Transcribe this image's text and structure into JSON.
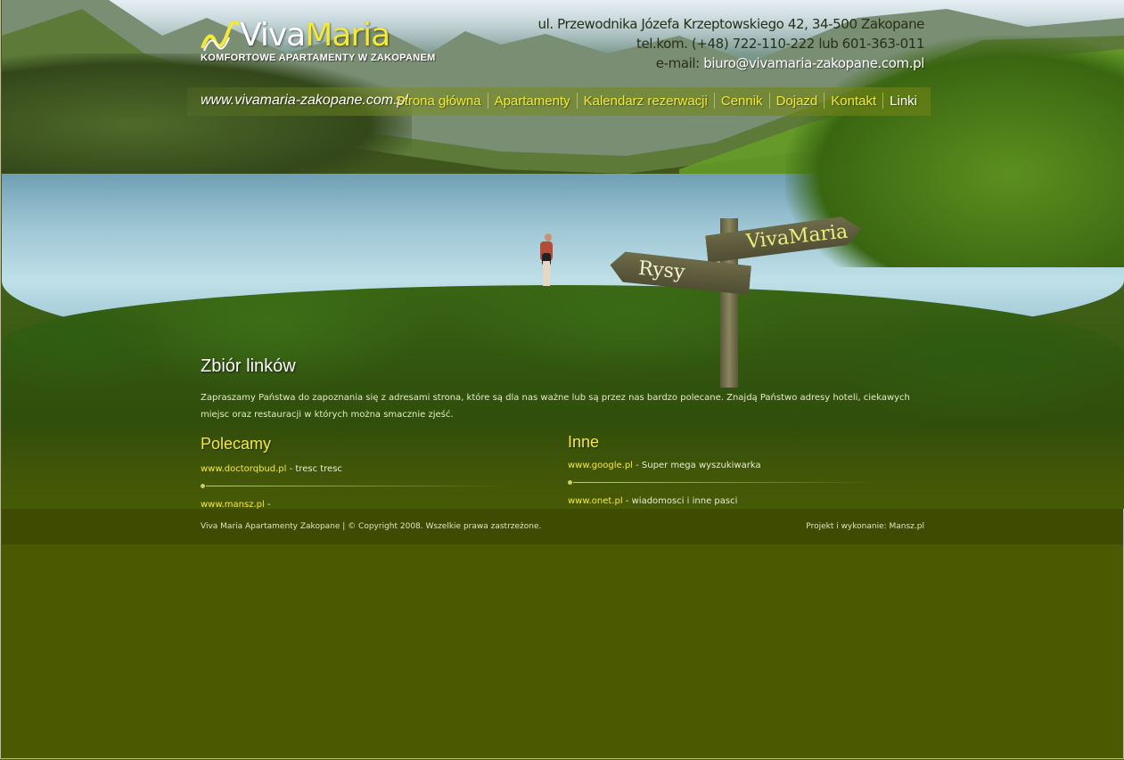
{
  "header": {
    "logo_viva": "Viva",
    "logo_maria": "Maria",
    "tagline": "KOMFORTOWE APARTAMENTY W ZAKOPANEM",
    "address": "ul. Przewodnika Józefa Krzeptowskiego 42, 34-500 Zakopane",
    "phone_label": "tel.kom.",
    "phone": "(+48) 722-110-222 lub 601-363-011",
    "email_label": "e-mail:",
    "email": "biuro@vivamaria-zakopane.com.pl",
    "site_url": "www.vivamaria-zakopane.com.pl"
  },
  "nav": {
    "items": [
      {
        "label": "Strona główna"
      },
      {
        "label": "Apartamenty"
      },
      {
        "label": "Kalendarz rezerwacji"
      },
      {
        "label": "Cennik"
      },
      {
        "label": "Dojazd"
      },
      {
        "label": "Kontakt"
      },
      {
        "label": "Linki"
      }
    ],
    "active": "Linki"
  },
  "hero": {
    "sign_right": "VivaMaria",
    "sign_left": "Rysy"
  },
  "content": {
    "title": "Zbiór linków",
    "intro": "Zapraszamy Państwa do zapoznania się z adresami strona, które są dla nas ważne lub są przez nas bardzo polecane. Znajdą Państwo adresy hoteli, ciekawych miejsc oraz restauracji w których można smacznie zjeść.",
    "columns": [
      {
        "title": "Polecamy",
        "links": [
          {
            "url": "www.doctorqbud.pl",
            "desc": " - tresc tresc"
          },
          {
            "url": "www.mansz.pl",
            "desc": " -"
          }
        ]
      },
      {
        "title": "Inne",
        "links": [
          {
            "url": "www.google.pl",
            "desc": " - Super mega wyszukiwarka"
          },
          {
            "url": "www.onet.pl",
            "desc": " - wiadomosci i inne pasci"
          }
        ]
      }
    ]
  },
  "footer": {
    "copyright": "Viva Maria Apartamenty Zakopane | © Copyright 2008. Wszelkie prawa zastrzeżone.",
    "credit": "Projekt i wykonanie: Mansz.pl"
  },
  "colors": {
    "accent_yellow": "#f5ea32",
    "page_bg": "#4b5a00",
    "footer_bg": "#3e4b00"
  }
}
